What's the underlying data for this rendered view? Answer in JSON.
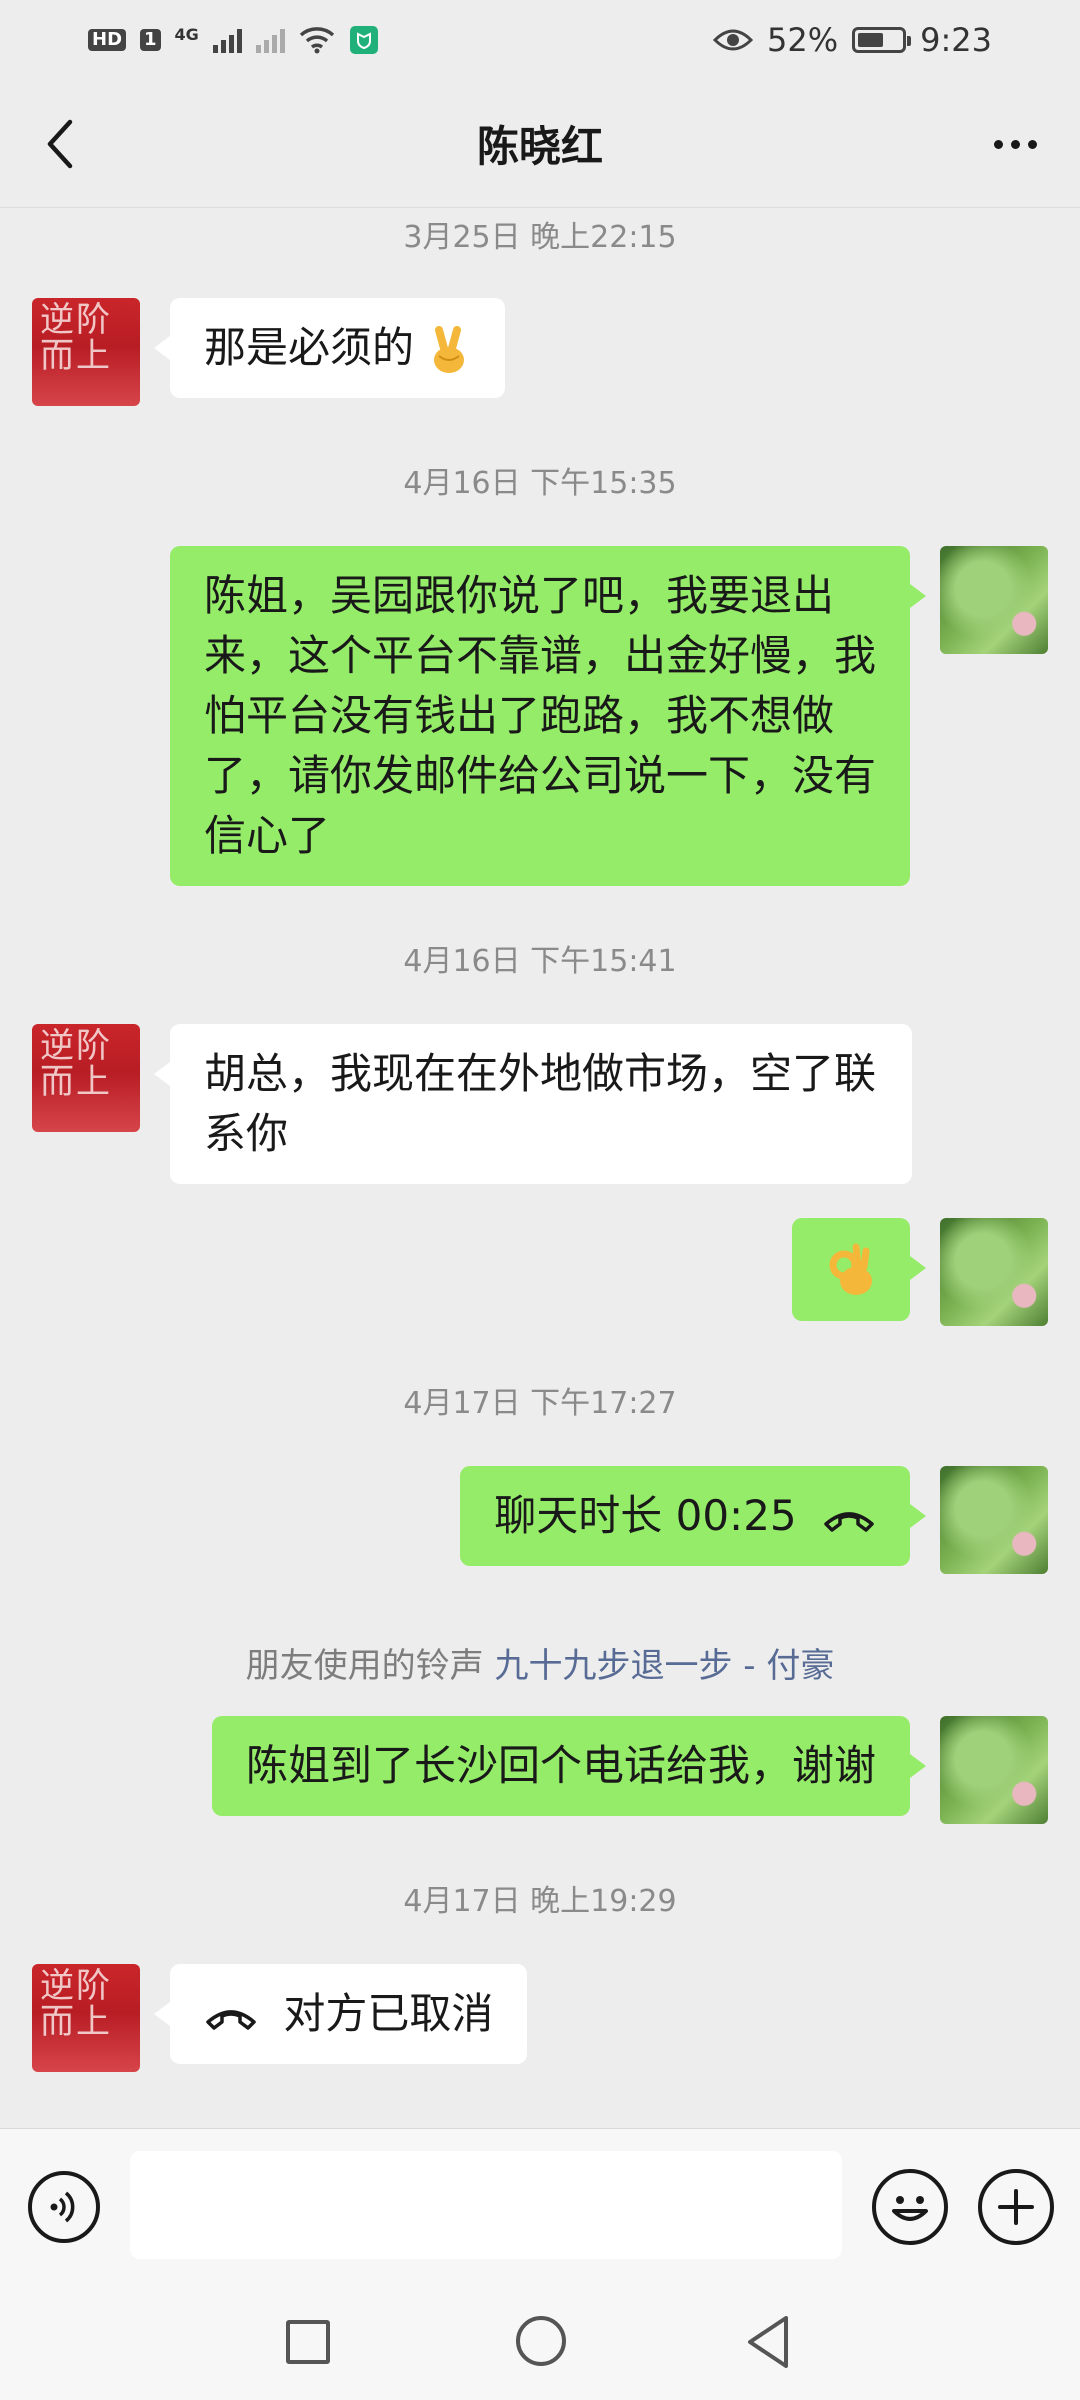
{
  "status_bar": {
    "hd_label": "HD",
    "sim_label": "1",
    "network_label": "4G",
    "battery_percent": "52%",
    "battery_level": 0.52,
    "time": "9:23"
  },
  "nav": {
    "title": "陈晓红",
    "back_icon": "chevron-left-icon",
    "more_icon": "more-dots-icon"
  },
  "chat": {
    "messages": [
      {
        "type": "timestamp",
        "text": "3月25日 晚上22:15"
      },
      {
        "type": "message",
        "from": "them",
        "text": "那是必须的",
        "emoji": "victory-hand-emoji"
      },
      {
        "type": "timestamp",
        "text": "4月16日 下午15:35"
      },
      {
        "type": "message",
        "from": "me",
        "text": "陈姐，吴园跟你说了吧，我要退出来，这个平台不靠谱，出金好慢，我怕平台没有钱出了跑路，我不想做了，请你发邮件给公司说一下，没有信心了"
      },
      {
        "type": "timestamp",
        "text": "4月16日 下午15:41"
      },
      {
        "type": "message",
        "from": "them",
        "text": "胡总，我现在在外地做市场，空了联系你"
      },
      {
        "type": "message",
        "from": "me",
        "emoji": "ok-hand-emoji"
      },
      {
        "type": "timestamp",
        "text": "4月17日 下午17:27"
      },
      {
        "type": "call",
        "from": "me",
        "text": "聊天时长 00:25"
      },
      {
        "type": "ringtone",
        "prefix": "朋友使用的铃声 ",
        "song": "九十九步退一步 - 付豪"
      },
      {
        "type": "message",
        "from": "me",
        "text": "陈姐到了长沙回个电话给我，谢谢"
      },
      {
        "type": "timestamp",
        "text": "4月17日 晚上19:29"
      },
      {
        "type": "call",
        "from": "them",
        "text": "对方已取消"
      }
    ]
  },
  "avatars": {
    "them_text": "逆阶而上"
  },
  "input_bar": {
    "voice_icon": "voice-icon",
    "emoji_icon": "emoji-smile-icon",
    "plus_icon": "plus-icon"
  },
  "system_nav": {
    "recent_icon": "square-icon",
    "home_icon": "circle-icon",
    "back_icon": "triangle-back-icon"
  }
}
